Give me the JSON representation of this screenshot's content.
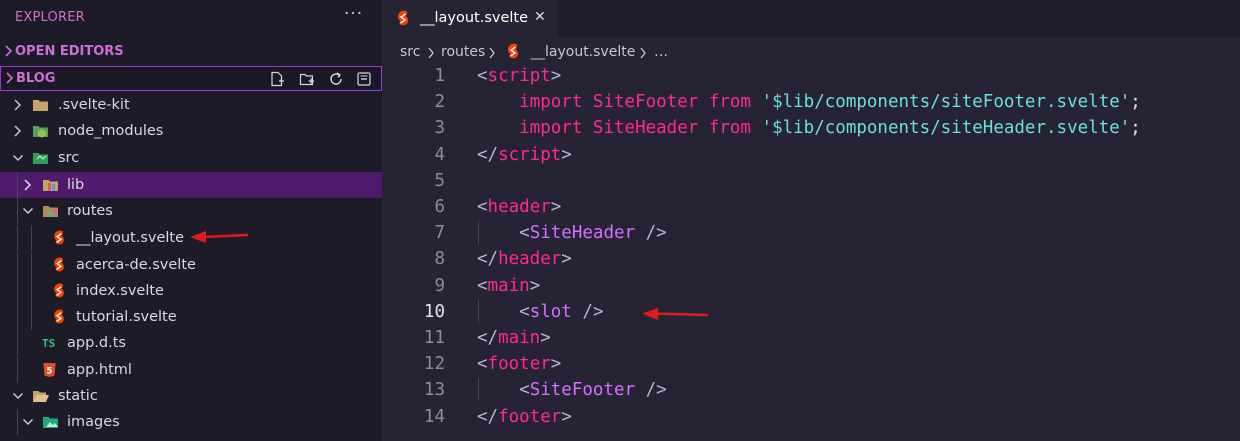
{
  "sidebar": {
    "title": "EXPLORER",
    "more": "···",
    "sections": {
      "open_editors": "OPEN EDITORS",
      "project": "BLOG"
    },
    "toolbar_icons": [
      "new-file-icon",
      "new-folder-icon",
      "refresh-icon",
      "collapse-all-icon"
    ],
    "tree": [
      {
        "name": ".svelte-kit",
        "type": "folder",
        "expanded": false
      },
      {
        "name": "node_modules",
        "type": "folder",
        "expanded": false
      },
      {
        "name": "src",
        "type": "folder",
        "expanded": true
      },
      {
        "name": "lib",
        "type": "folder",
        "expanded": false,
        "selected": true
      },
      {
        "name": "routes",
        "type": "folder",
        "expanded": true
      },
      {
        "name": "__layout.svelte",
        "type": "svelte"
      },
      {
        "name": "acerca-de.svelte",
        "type": "svelte"
      },
      {
        "name": "index.svelte",
        "type": "svelte"
      },
      {
        "name": "tutorial.svelte",
        "type": "svelte"
      },
      {
        "name": "app.d.ts",
        "type": "ts",
        "badge": "TS"
      },
      {
        "name": "app.html",
        "type": "html",
        "badge": "5"
      },
      {
        "name": "static",
        "type": "folder",
        "expanded": true
      },
      {
        "name": "images",
        "type": "folder",
        "expanded": true
      }
    ]
  },
  "editor": {
    "tab": {
      "title": "__layout.svelte",
      "close": "✕"
    },
    "breadcrumb": [
      "src",
      "routes",
      "__layout.svelte",
      "…"
    ],
    "lines": [
      {
        "n": "1",
        "tokens": [
          [
            "br",
            "<"
          ],
          [
            "pk",
            "script"
          ],
          [
            "br",
            ">"
          ]
        ]
      },
      {
        "n": "2",
        "tokens": [
          [
            "pl",
            "    "
          ],
          [
            "pk",
            "import"
          ],
          [
            "pl",
            " "
          ],
          [
            "pk",
            "SiteFooter"
          ],
          [
            "pl",
            " "
          ],
          [
            "pk",
            "from"
          ],
          [
            "pl",
            " "
          ],
          [
            "st",
            "'$lib/components/siteFooter.svelte'"
          ],
          [
            "pl",
            ";"
          ]
        ]
      },
      {
        "n": "3",
        "tokens": [
          [
            "pl",
            "    "
          ],
          [
            "pk",
            "import"
          ],
          [
            "pl",
            " "
          ],
          [
            "pk",
            "SiteHeader"
          ],
          [
            "pl",
            " "
          ],
          [
            "pk",
            "from"
          ],
          [
            "pl",
            " "
          ],
          [
            "st",
            "'$lib/components/siteHeader.svelte'"
          ],
          [
            "pl",
            ";"
          ]
        ]
      },
      {
        "n": "4",
        "tokens": [
          [
            "br",
            "</"
          ],
          [
            "pk",
            "script"
          ],
          [
            "br",
            ">"
          ]
        ]
      },
      {
        "n": "5",
        "tokens": []
      },
      {
        "n": "6",
        "tokens": [
          [
            "br",
            "<"
          ],
          [
            "pk",
            "header"
          ],
          [
            "br",
            ">"
          ]
        ]
      },
      {
        "n": "7",
        "tokens": [
          [
            "pl",
            "    "
          ],
          [
            "br",
            "<"
          ],
          [
            "pu",
            "SiteHeader"
          ],
          [
            "pl",
            " "
          ],
          [
            "br",
            "/>"
          ]
        ]
      },
      {
        "n": "8",
        "tokens": [
          [
            "br",
            "</"
          ],
          [
            "pk",
            "header"
          ],
          [
            "br",
            ">"
          ]
        ]
      },
      {
        "n": "9",
        "tokens": [
          [
            "br",
            "<"
          ],
          [
            "pk",
            "main"
          ],
          [
            "br",
            ">"
          ]
        ]
      },
      {
        "n": "10",
        "tokens": [
          [
            "pl",
            "    "
          ],
          [
            "br",
            "<"
          ],
          [
            "pu",
            "slot"
          ],
          [
            "pl",
            " "
          ],
          [
            "br",
            "/>"
          ]
        ]
      },
      {
        "n": "11",
        "tokens": [
          [
            "br",
            "</"
          ],
          [
            "pk",
            "main"
          ],
          [
            "br",
            ">"
          ]
        ]
      },
      {
        "n": "12",
        "tokens": [
          [
            "br",
            "<"
          ],
          [
            "pk",
            "footer"
          ],
          [
            "br",
            ">"
          ]
        ]
      },
      {
        "n": "13",
        "tokens": [
          [
            "pl",
            "    "
          ],
          [
            "br",
            "<"
          ],
          [
            "pu",
            "SiteFooter"
          ],
          [
            "pl",
            " "
          ],
          [
            "br",
            "/>"
          ]
        ]
      },
      {
        "n": "14",
        "tokens": [
          [
            "br",
            "</"
          ],
          [
            "pk",
            "footer"
          ],
          [
            "br",
            ">"
          ]
        ]
      }
    ]
  },
  "colors": {
    "sidebar_bg": "#1e1b29",
    "editor_bg": "#262335",
    "accent": "#cf6fd6",
    "selection": "#4f1a6a",
    "tag": "#ff2b8a",
    "component": "#d46fff",
    "string": "#66e3d6",
    "annotation_arrow": "#e01b1b"
  },
  "annotations": [
    "red-arrow-to-layout-file",
    "red-arrow-to-slot-line"
  ]
}
